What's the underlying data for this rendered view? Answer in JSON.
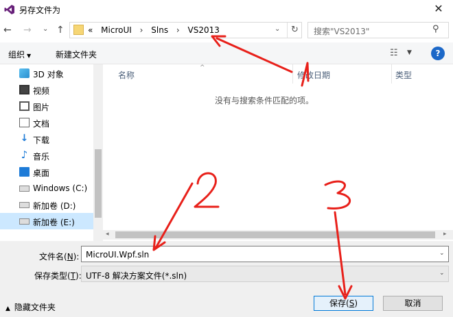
{
  "window": {
    "title": "另存文件为",
    "close_glyph": "✕"
  },
  "navigation": {
    "breadcrumb_lead": "«",
    "breadcrumb": [
      "MicroUI",
      "Slns",
      "VS2013"
    ],
    "separator": "›",
    "search_placeholder": "搜索\"VS2013\""
  },
  "toolbar": {
    "organize_label": "组织",
    "new_folder_label": "新建文件夹"
  },
  "sidebar": {
    "items": [
      {
        "label": "3D 对象",
        "icon": "cube-icon"
      },
      {
        "label": "视频",
        "icon": "video-icon"
      },
      {
        "label": "图片",
        "icon": "picture-icon"
      },
      {
        "label": "文档",
        "icon": "document-icon"
      },
      {
        "label": "下载",
        "icon": "download-icon"
      },
      {
        "label": "音乐",
        "icon": "music-icon"
      },
      {
        "label": "桌面",
        "icon": "desktop-icon"
      },
      {
        "label": "Windows (C:)",
        "icon": "windows-drive-icon"
      },
      {
        "label": "新加卷 (D:)",
        "icon": "drive-icon"
      },
      {
        "label": "新加卷 (E:)",
        "icon": "drive-icon",
        "selected": true
      }
    ]
  },
  "file_list": {
    "columns": [
      "名称",
      "修改日期",
      "类型"
    ],
    "empty_message": "没有与搜索条件匹配的项。"
  },
  "form": {
    "filename_label": "文件名(",
    "filename_hotkey": "N",
    "filename_label_end": "):",
    "filename_value": "MicroUI.Wpf.sln",
    "filetype_label": "保存类型(",
    "filetype_hotkey": "T",
    "filetype_label_end": "):",
    "filetype_value": "UTF-8 解决方案文件(*.sln)"
  },
  "footer": {
    "hide_folders_label": "隐藏文件夹",
    "save_label": "保存(",
    "save_hotkey": "S",
    "save_label_end": ")",
    "cancel_label": "取消"
  },
  "annotations": {
    "numbers": [
      "1",
      "2",
      "3"
    ],
    "color": "#e8201a"
  },
  "colors": {
    "selected_bg": "#cce8ff",
    "accent": "#0078d7",
    "help": "#1c68c8"
  }
}
